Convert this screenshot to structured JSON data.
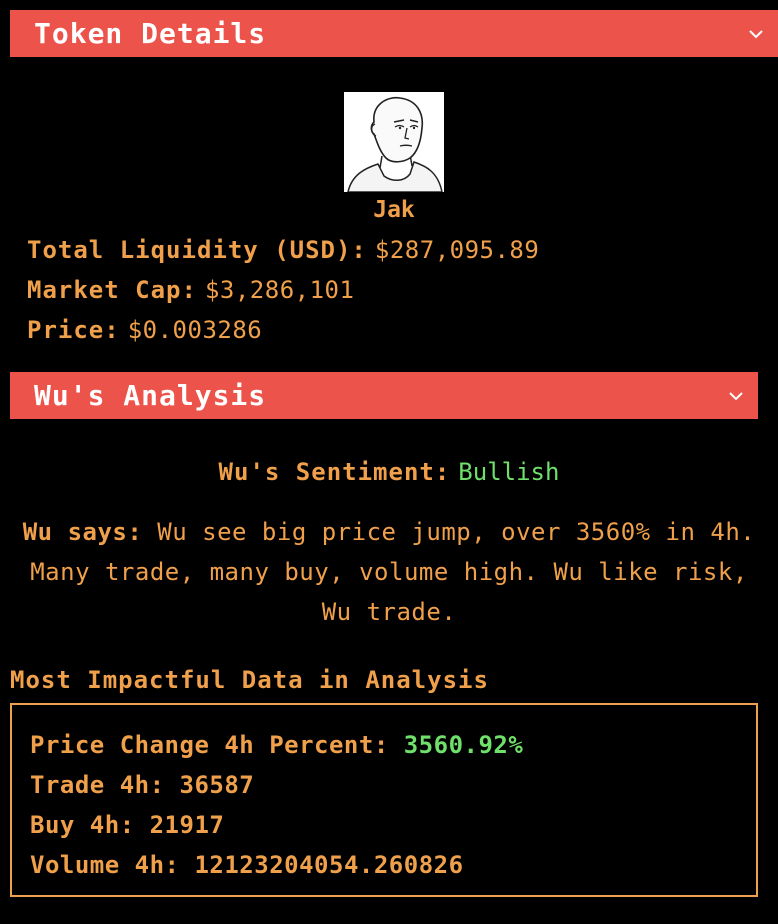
{
  "token_details": {
    "header": "Token Details",
    "collapse_icon": "chevron-down-icon",
    "token_name": "Jak",
    "image": "wojak-face",
    "liquidity_label": "Total Liquidity (USD):",
    "liquidity_value": "$287,095.89",
    "market_cap_label": "Market Cap:",
    "market_cap_value": "$3,286,101",
    "price_label": "Price:",
    "price_value": "$0.003286"
  },
  "analysis": {
    "header": "Wu's Analysis",
    "collapse_icon": "chevron-down-icon",
    "sentiment_label": "Wu's Sentiment:",
    "sentiment_value": "Bullish",
    "says_label": "Wu says:",
    "says_text": "Wu see big price jump, over 3560% in 4h. Many trade, many buy, volume high. Wu like risk, Wu trade.",
    "impact_heading": "Most Impactful Data in Analysis",
    "impact_items": [
      {
        "label": "Price Change 4h Percent:",
        "value": "3560.92%"
      },
      {
        "label": "Trade 4h:",
        "value": "36587"
      },
      {
        "label": "Buy 4h:",
        "value": "21917"
      },
      {
        "label": "Volume 4h:",
        "value": "12123204054.260826"
      }
    ]
  },
  "colors": {
    "header_bg": "#ec544b",
    "text_accent": "#f0a04b",
    "positive": "#6fe06a",
    "background": "#000000"
  }
}
